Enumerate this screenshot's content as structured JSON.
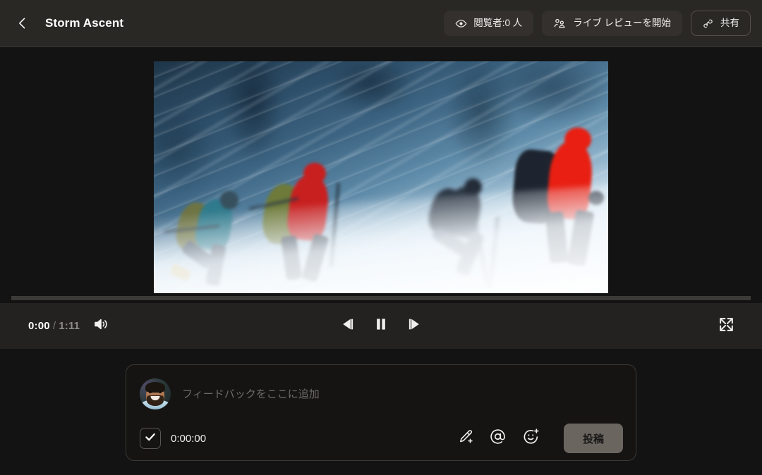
{
  "header": {
    "back_icon": "chevron-left-icon",
    "title": "Storm Ascent",
    "actions": [
      {
        "id": "viewers",
        "icon": "eye-icon",
        "label": "閲覧者:0 人",
        "style": "filled"
      },
      {
        "id": "live-review",
        "icon": "people-icon",
        "label": "ライブ レビューを開始",
        "style": "filled"
      },
      {
        "id": "share",
        "icon": "link-icon",
        "label": "共有",
        "style": "outlined"
      }
    ]
  },
  "video": {
    "alt": "吹雪の斜面を登る4人の登山者（モーションブラー）",
    "hikers": [
      {
        "jacket": "#2f7a8c",
        "pack": "#6d7342",
        "pants": "#3b4a5c"
      },
      {
        "jacket": "#c81f1f",
        "pack": "#6e7a3a",
        "pants": "#1b2430"
      },
      {
        "jacket": "#2b3644",
        "pack": "#3a4450",
        "pants": "#4a5362"
      },
      {
        "jacket": "#e81f12",
        "pack": "#1d2430",
        "pants": "#161c26"
      }
    ]
  },
  "player": {
    "current_time": "0:00",
    "time_separator": "/",
    "duration": "1:11",
    "progress_percent": 0,
    "volume_icon": "volume-icon",
    "step_back_icon": "step-backward-icon",
    "play_pause_icon": "pause-icon",
    "step_forward_icon": "step-forward-icon",
    "fullscreen_icon": "fullscreen-icon"
  },
  "comment": {
    "avatar_icon": "user-avatar",
    "placeholder": "フィードバックをここに追加",
    "value": "",
    "timestamp_checked": true,
    "timestamp": "0:00:00",
    "tools": [
      {
        "id": "draw",
        "icon": "pencil-plus-icon"
      },
      {
        "id": "mention",
        "icon": "at-sign-icon"
      },
      {
        "id": "emoji",
        "icon": "emoji-plus-icon"
      }
    ],
    "post_label": "投稿"
  },
  "colors": {
    "header_bg": "#2a2825",
    "page_bg": "#131313",
    "control_bg": "#232221",
    "button_bg": "#33302d",
    "post_button_bg": "#6b6560",
    "track": "#3c3a38",
    "text": "#f2f0ee",
    "muted_text": "#8e8a87"
  }
}
